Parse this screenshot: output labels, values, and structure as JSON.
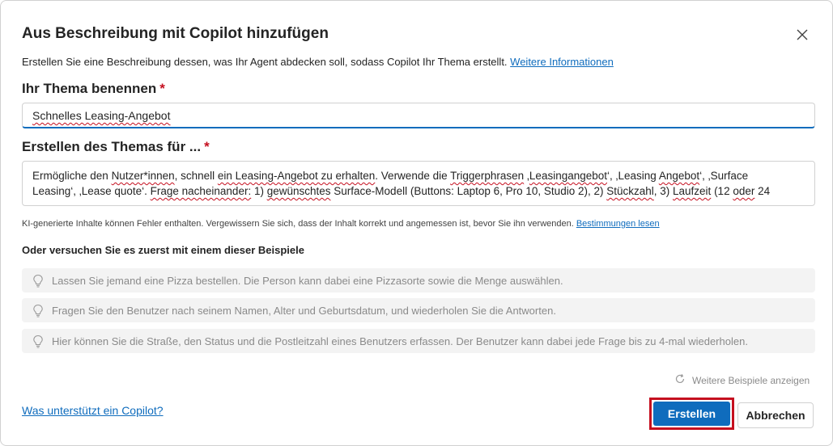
{
  "dialog": {
    "title": "Aus Beschreibung mit Copilot hinzufügen",
    "description": "Erstellen Sie eine Beschreibung dessen, was Ihr Agent abdecken soll, sodass Copilot Ihr Thema erstellt.",
    "description_link": "Weitere Informationen"
  },
  "topic_name": {
    "label": "Ihr Thema benennen",
    "required_mark": "*",
    "value": "Schnelles Leasing-Angebot"
  },
  "topic_description": {
    "label": "Erstellen des Themas für ...",
    "required_mark": "*",
    "line1_a": "Ermögliche den ",
    "line1_b": "Nutzer*innen",
    "line1_c": ", schnell ",
    "line1_d": "ein Leasing-Angebot zu erhalten",
    "line1_e": ". Verwende die ",
    "line1_f": "Triggerphrasen",
    "line1_g": " ‚",
    "line1_h": "Leasingangebot",
    "line1_i": "‘, ‚Leasing ",
    "line1_j": "Angebot",
    "line1_k": "‘, ‚Surface",
    "line2_a": "Leasing‘, ‚Lease quote‘. ",
    "line2_b": "Frage nacheinander:",
    "line2_c": " 1) ",
    "line2_d": "gewünschtes",
    "line2_e": " Surface-Modell (Buttons: Laptop 6, Pro 10, Studio 2), 2) ",
    "line2_f": "Stückzahl",
    "line2_g": ", 3) ",
    "line2_h": "Laufzeit",
    "line2_i": " (12 ",
    "line2_j": "oder",
    "line2_k": " 24"
  },
  "ai_note": {
    "text": "KI-generierte Inhalte können Fehler enthalten. Vergewissern Sie sich, dass der Inhalt korrekt und angemessen ist, bevor Sie ihn verwenden.",
    "link": "Bestimmungen lesen"
  },
  "examples": {
    "title": "Oder versuchen Sie es zuerst mit einem dieser Beispiele",
    "items": [
      "Lassen Sie jemand eine Pizza bestellen. Die Person kann dabei eine Pizzasorte sowie die Menge auswählen.",
      "Fragen Sie den Benutzer nach seinem Namen, Alter und Geburtsdatum, und wiederholen Sie die Antworten.",
      "Hier können Sie die Straße, den Status und die Postleitzahl eines Benutzers erfassen. Der Benutzer kann dabei jede Frage bis zu 4-mal wiederholen."
    ],
    "more_label": "Weitere Beispiele anzeigen"
  },
  "footer": {
    "help_link": "Was unterstützt ein Copilot?",
    "create_label": "Erstellen",
    "cancel_label": "Abbrechen"
  },
  "colors": {
    "accent": "#0f6cbd",
    "required": "#c50f1f",
    "highlight_border": "#c50f1f"
  }
}
